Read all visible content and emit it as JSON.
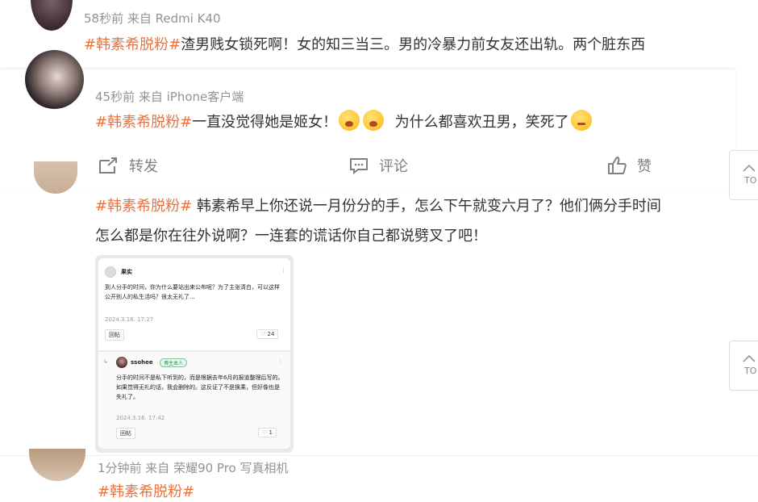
{
  "posts": [
    {
      "meta": "58秒前  来自 Redmi K40",
      "tag": "#韩素希脱粉#",
      "text": "渣男贱女锁死啊！女的知三当三。男的冷暴力前女友还出轨。两个脏东西"
    },
    {
      "meta": "45秒前  来自 iPhone客户端",
      "tag": "#韩素希脱粉#",
      "text_a": "一直没觉得她是姬女！",
      "text_b": "为什么都喜欢丑男，笑死了"
    },
    {
      "tag": "#韩素希脱粉#",
      "line1": " 韩素希早上你还说一月份分的手，怎么下午就变六月了？他们俩分手时间",
      "line2": "怎么都是你在往外说啊？一连套的谎话你自己都说劈叉了吧！"
    },
    {
      "meta": "1分钟前  来自 荣耀90 Pro 写真相机",
      "tag": "#韩素希脱粉#"
    }
  ],
  "actions": {
    "repost": "转发",
    "comment": "评论",
    "like": "赞"
  },
  "side": {
    "top_label": "TO",
    "bottom_label": "TO"
  },
  "screenshot": {
    "user1": "果实",
    "user1_text1": "到人分手的时间，你为什么要站出来公布呢？为了主张清白，可以这样",
    "user1_text2": "公开别人的私生活吗？很太无礼了...",
    "user1_time": "2024.3.16. 17:27",
    "user1_btn": "回帖",
    "user1_likes": "24",
    "user2": "ssohee",
    "user2_badge": "博主本人",
    "user2_text1": "分手的时间不是私下听到的，而是根据去年6月的报道整理后写的。",
    "user2_text2": "如果觉得无礼的话，我会删除的。这反证了不是换乘，但好像也是",
    "user2_text3": "失礼了。",
    "user2_time": "2024.3.16. 17:42",
    "user2_btn": "回帖",
    "user2_likes": "1"
  }
}
